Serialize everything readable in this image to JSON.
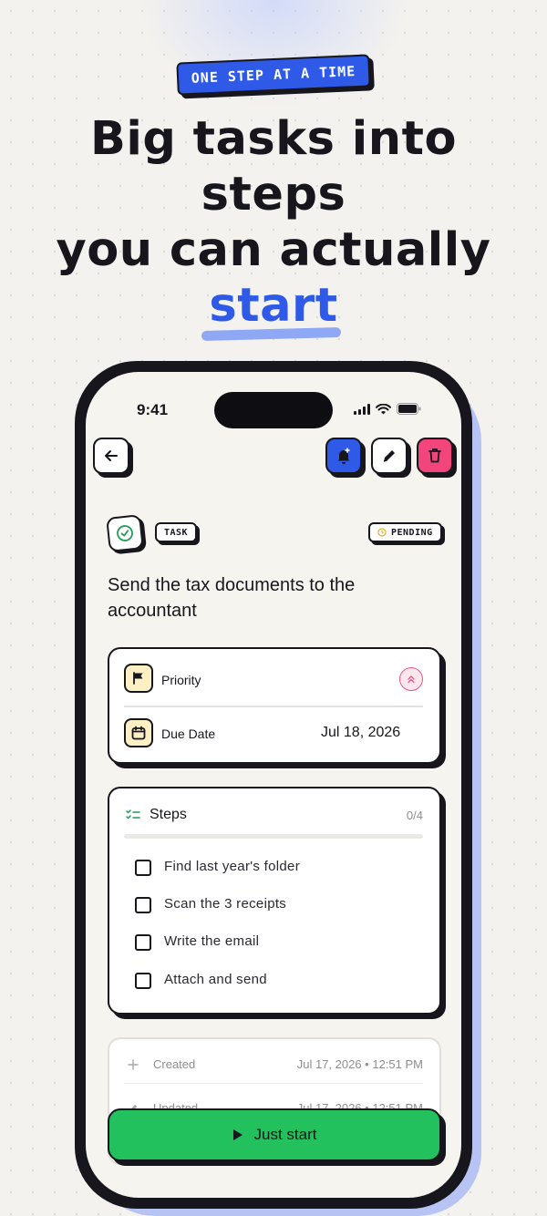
{
  "hero": {
    "kicker": "ONE STEP AT A TIME",
    "headline_line1": "Big tasks into",
    "headline_line2": "steps",
    "headline_line3": "you can actually",
    "headline_accent": "start",
    "accent_color": "#2f5ae8"
  },
  "status_bar": {
    "time": "9:41"
  },
  "toolbar": {
    "back_icon": "arrow-left-icon",
    "reminder_icon": "bell-plus-icon",
    "edit_icon": "pencil-icon",
    "delete_icon": "trash-icon",
    "reminder_color": "#2f5ae8",
    "delete_color": "#f2457b"
  },
  "task": {
    "type_chip": "TASK",
    "status_chip": "PENDING",
    "title": "Send the tax documents to the accountant"
  },
  "details": {
    "priority_label": "Priority",
    "due_label": "Due Date",
    "due_value": "Jul 18, 2026"
  },
  "steps": {
    "heading": "Steps",
    "count": "0/4",
    "progress": 0,
    "items": [
      {
        "label": "Find last year's folder",
        "done": false
      },
      {
        "label": "Scan the 3 receipts",
        "done": false
      },
      {
        "label": "Write the email",
        "done": false
      },
      {
        "label": "Attach and send",
        "done": false
      }
    ]
  },
  "meta": {
    "created_label": "Created",
    "created_value": "Jul 17, 2026 • 12:51 PM",
    "updated_label": "Updated",
    "updated_value": "Jul 17, 2026 • 12:51 PM"
  },
  "cta": {
    "label": "Just start",
    "color": "#23c15d"
  }
}
